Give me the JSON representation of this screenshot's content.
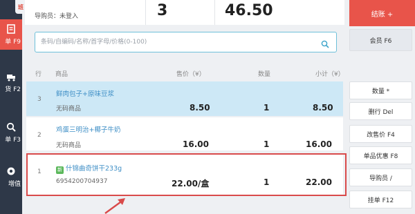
{
  "nav": {
    "badge": "班",
    "items": [
      {
        "label": "单 F9",
        "icon": "checklist-icon"
      },
      {
        "label": "货 F2",
        "icon": "delivery-icon"
      },
      {
        "label": "单 F3",
        "icon": "search-icon"
      },
      {
        "label": "増值",
        "icon": "value-added-icon"
      }
    ]
  },
  "summary": {
    "clerk_label": "导购员：未登入",
    "quantity": "3",
    "total": "46.50"
  },
  "search": {
    "placeholder": "条码/自编码/名称/首字母/价格(0-100)"
  },
  "table": {
    "headers": {
      "line": "行",
      "product": "商品",
      "price": "售价（¥）",
      "qty": "数量",
      "subtotal": "小计（¥）"
    },
    "rows": [
      {
        "line": "3",
        "name": "鲜肉包子+原味豆浆",
        "sub": "无码商品",
        "price": "8.50",
        "qty": "1",
        "subtotal": "8.50",
        "selected": true
      },
      {
        "line": "2",
        "name": "鸡蛋三明治+椰子牛奶",
        "sub": "无码商品",
        "price": "16.00",
        "qty": "1",
        "subtotal": "16.00",
        "selected": false
      },
      {
        "line": "1",
        "tag": "新",
        "name": "什锦曲奇饼干233g",
        "sub": "6954200704937",
        "price": "22.00/盒",
        "qty": "1",
        "subtotal": "22.00",
        "selected": false
      }
    ]
  },
  "right": {
    "checkout": "结账 +",
    "member": "会员 F6",
    "quantity": "数量 *",
    "delete_row": "删行 Del",
    "change_price": "改售价 F4",
    "item_discount": "单品优惠 F8",
    "salesperson": "导购员 /",
    "hold_order": "挂单 F12"
  },
  "colors": {
    "accent": "#e8544a",
    "nav": "#2e3848",
    "link": "#3f8fc6",
    "selected_row": "#cde8f6",
    "annotation": "#d94a4a"
  }
}
